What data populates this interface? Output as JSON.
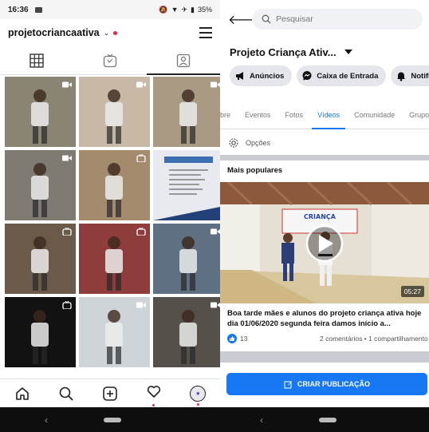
{
  "instagram": {
    "status": {
      "time": "16:36",
      "battery": "35%"
    },
    "username": "projetocriancaativa",
    "grid": [
      {
        "bg": "#8a8474",
        "badge": "video"
      },
      {
        "bg": "#c7b9a6",
        "badge": "video"
      },
      {
        "bg": "#a99a84",
        "badge": "video"
      },
      {
        "bg": "#7f7a72",
        "badge": "video"
      },
      {
        "bg": "#a48b6e",
        "badge": "igtv"
      },
      {
        "bg": "#e9eaf0",
        "badge": ""
      },
      {
        "bg": "#6b5a4a",
        "badge": "igtv"
      },
      {
        "bg": "#8f3c3c",
        "badge": "igtv"
      },
      {
        "bg": "#5f7083",
        "badge": "video"
      },
      {
        "bg": "#121212",
        "badge": "igtv"
      },
      {
        "bg": "#cfd4d8",
        "badge": "video"
      },
      {
        "bg": "#55504a",
        "badge": "video"
      }
    ]
  },
  "facebook": {
    "search_placeholder": "Pesquisar",
    "page_title": "Projeto Criança Ativ...",
    "actions": [
      "Anúncios",
      "Caixa de Entrada",
      "Notificações"
    ],
    "subtabs": [
      "bre",
      "Eventos",
      "Fotos",
      "Vídeos",
      "Comunidade",
      "Grupos"
    ],
    "active_subtab": "Vídeos",
    "options_label": "Opções",
    "section_title": "Mais populares",
    "video": {
      "duration": "05:27",
      "banner_text": "CRIANÇA",
      "caption": "Boa tarde mães e alunos do projeto criança ativa hoje dia 01/06/2020 segunda feira  damos início a...",
      "likes": "13",
      "comments_shares": "2 comentários • 1 compartilhamento"
    },
    "create_post": "CRIAR PUBLICAÇÃO"
  },
  "colors": {
    "fb_blue": "#1877f2",
    "ig_red": "#e5264f"
  }
}
